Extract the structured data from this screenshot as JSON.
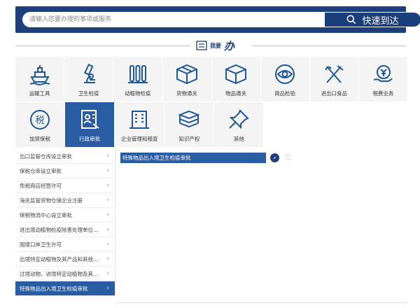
{
  "search": {
    "placeholder": "请输入您要办理的事项或服务",
    "button_label": "快速到达"
  },
  "section": {
    "prefix": "我要",
    "banner": "办"
  },
  "categories_row1": [
    {
      "label": "运输工具",
      "icon": "ship-icon"
    },
    {
      "label": "卫生检疫",
      "icon": "microscope-icon"
    },
    {
      "label": "动植物检疫",
      "icon": "test-tubes-icon"
    },
    {
      "label": "货物通关",
      "icon": "cargo-box-icon"
    },
    {
      "label": "物品通关",
      "icon": "package-icon"
    },
    {
      "label": "商品检验",
      "icon": "eye-inspect-icon"
    },
    {
      "label": "进出口食品",
      "icon": "fork-knife-icon"
    },
    {
      "label": "税费业务",
      "icon": "yuan-coin-icon"
    }
  ],
  "categories_row2": [
    {
      "label": "加贸保税",
      "icon": "tax-badge-icon"
    },
    {
      "label": "行政审批",
      "icon": "approval-doc-icon"
    },
    {
      "label": "企业管理和稽查",
      "icon": "building-icon"
    },
    {
      "label": "知识产权",
      "icon": "books-stack-icon"
    },
    {
      "label": "其他",
      "icon": "pushpin-icon"
    }
  ],
  "active_category": "行政审批",
  "sub_items": [
    "出口监管仓库设立审批",
    "保税仓库设立审批",
    "免税商店经营许可",
    "海关监管货物仓储企业注册",
    "保税物流中心设立审批",
    "进出境动植物检疫除害处理单位核准",
    "国境口岸卫生许可",
    "出境特定动植物及其产品和其他检...",
    "过境动物、进境特定动植物及其产...",
    "特殊物品出入境卫生检疫审批"
  ],
  "active_sub_item": "特殊物品出入境卫生检疫审批",
  "result": {
    "label": "特殊物品出入境卫生检疫审批"
  },
  "colors": {
    "primary": "#1e3f7a",
    "active": "#2a5ca3",
    "icon": "#1e5799",
    "tile_bg": "#f4f4f4"
  }
}
